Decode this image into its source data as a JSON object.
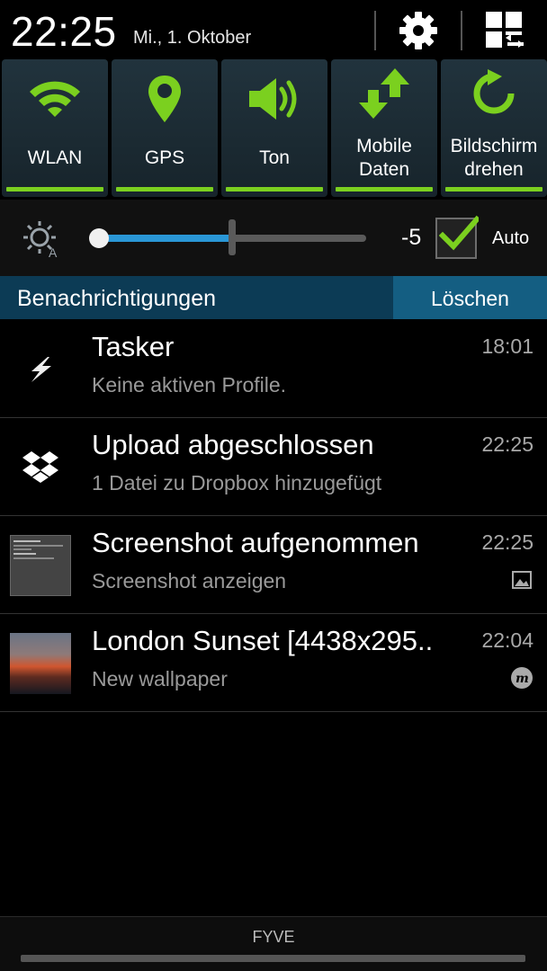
{
  "header": {
    "time": "22:25",
    "date": "Mi., 1. Oktober",
    "settings_icon": "gear-icon",
    "toggle_grid_icon": "quick-settings-grid-icon"
  },
  "toggles": [
    {
      "label": "WLAN",
      "icon": "wifi-icon",
      "active": true
    },
    {
      "label": "GPS",
      "icon": "location-pin-icon",
      "active": true
    },
    {
      "label": "Ton",
      "icon": "volume-icon",
      "active": true
    },
    {
      "label_line1": "Mobile",
      "label_line2": "Daten",
      "icon": "mobile-data-icon",
      "active": true
    },
    {
      "label_line1": "Bildschirm",
      "label_line2": "drehen",
      "icon": "rotate-icon",
      "active": true
    }
  ],
  "brightness": {
    "icon": "auto-brightness-icon",
    "level_fraction": 0.5,
    "value": "-5",
    "auto_checked": true,
    "auto_label": "Auto"
  },
  "notifications_header": {
    "title": "Benachrichtigungen",
    "clear_label": "Löschen"
  },
  "notifications": [
    {
      "title": "Tasker",
      "subtitle": "Keine aktiven Profile.",
      "time": "18:01",
      "icon": "lightning-icon"
    },
    {
      "title": "Upload abgeschlossen",
      "subtitle": "1 Datei zu Dropbox hinzugefügt",
      "time": "22:25",
      "icon": "dropbox-icon"
    },
    {
      "title": "Screenshot aufgenommen",
      "subtitle": "Screenshot anzeigen",
      "time": "22:25",
      "icon": "screenshot-thumbnail",
      "small_icon": "image-icon"
    },
    {
      "title": "London Sunset [4438x295..",
      "subtitle": "New wallpaper",
      "time": "22:04",
      "icon": "sunset-thumbnail",
      "small_icon": "muzei-icon"
    }
  ],
  "bottom": {
    "carrier": "FYVE"
  },
  "colors": {
    "accent_green": "#7bd01f",
    "slider_blue": "#2a97d6",
    "notif_header": "#0c3b55",
    "clear_button": "#145e82"
  }
}
